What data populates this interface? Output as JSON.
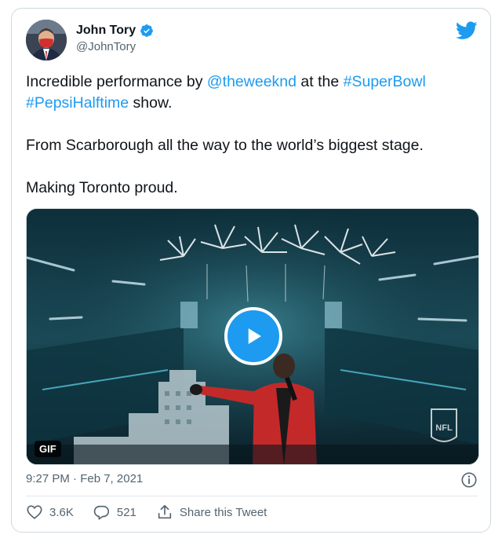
{
  "author": {
    "display_name": "John Tory",
    "handle": "@JohnTory"
  },
  "tweet": {
    "line1_text_a": "Incredible performance by ",
    "line1_mention": "@theweeknd",
    "line1_text_b": " at the ",
    "line1_hashtag": "#SuperBowl",
    "line2_hashtag": "#PepsiHalftime",
    "line2_text": " show.",
    "para2": "From Scarborough all the way to the world’s biggest stage.",
    "para3": "Making Toronto proud."
  },
  "media": {
    "badge": "GIF",
    "watermark": "NFL"
  },
  "timestamp": "9:27 PM · Feb 7, 2021",
  "actions": {
    "likes": "3.6K",
    "replies": "521",
    "share_label": "Share this Tweet"
  },
  "colors": {
    "link": "#1d9bf0",
    "secondary_text": "#536471",
    "border": "#cfd9de"
  },
  "icons": [
    "verified-badge-icon",
    "twitter-bird-icon",
    "play-icon",
    "info-icon",
    "heart-icon",
    "reply-icon",
    "share-icon"
  ]
}
